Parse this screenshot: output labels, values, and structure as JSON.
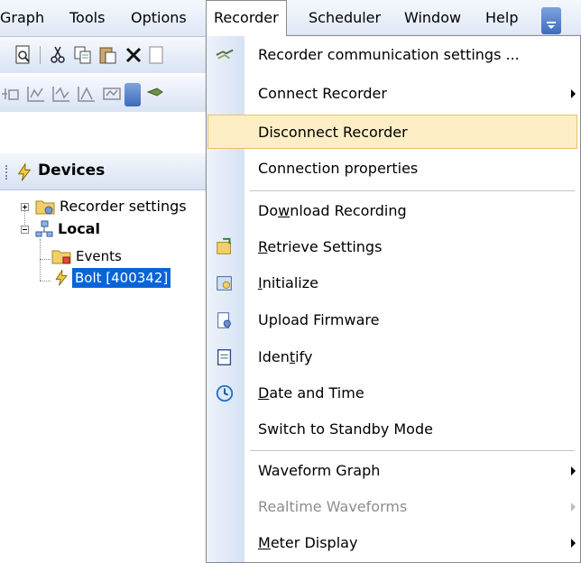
{
  "menubar": {
    "items": [
      {
        "label": "Graph"
      },
      {
        "label": "Tools"
      },
      {
        "label": "Options"
      },
      {
        "label": "Recorder",
        "open": true
      },
      {
        "label": "Scheduler"
      },
      {
        "label": "Window"
      },
      {
        "label": "Help"
      }
    ]
  },
  "devices_pane": {
    "title": "Devices",
    "tree": [
      {
        "label": "Recorder settings",
        "icon": "folder-settings-icon"
      },
      {
        "label": "Local",
        "icon": "network-icon",
        "bold": true
      },
      {
        "label": "Events",
        "icon": "folder-icon"
      },
      {
        "label": "Bolt [400342]",
        "icon": "bolt-icon",
        "selected": true
      }
    ]
  },
  "recorder_menu": {
    "items": [
      {
        "label": "Recorder communication settings ...",
        "icon": "plug-icon"
      },
      {
        "label": "Connect Recorder",
        "submenu": true
      },
      {
        "label": "Disconnect Recorder",
        "highlighted": true
      },
      {
        "label": "Connection properties"
      },
      {
        "label": "Download Recording",
        "mnemonic": "w"
      },
      {
        "label": "Retrieve Settings",
        "icon": "retrieve-icon",
        "mnemonic": "R"
      },
      {
        "label": "Initialize",
        "icon": "initialize-icon",
        "mnemonic": "I"
      },
      {
        "label": "Upload Firmware",
        "icon": "firmware-icon"
      },
      {
        "label": "Identify",
        "icon": "identify-icon",
        "mnemonic": "t"
      },
      {
        "label": "Date and Time",
        "icon": "clock-icon",
        "mnemonic": "D"
      },
      {
        "label": "Switch to Standby Mode"
      },
      {
        "label": "Waveform Graph",
        "submenu": true
      },
      {
        "label": "Realtime Waveforms",
        "submenu": true,
        "disabled": true
      },
      {
        "label": "Meter Display",
        "submenu": true,
        "mnemonic": "M"
      }
    ]
  },
  "colors": {
    "highlight_bg": "#fdeec6",
    "highlight_border": "#e5c365",
    "selection": "#0a64d8",
    "gutter": "#d6e2f4"
  }
}
